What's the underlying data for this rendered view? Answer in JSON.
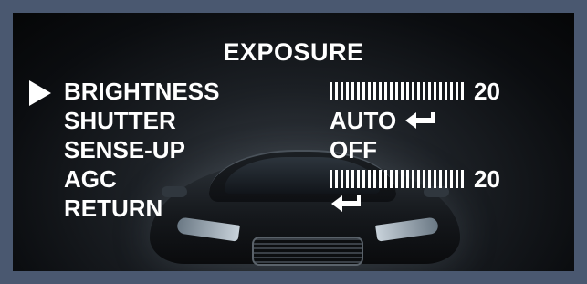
{
  "menu": {
    "title": "EXPOSURE",
    "items": [
      {
        "label": "BRIGHTNESS",
        "value": "20",
        "bar_level": 20,
        "selected": true
      },
      {
        "label": "SHUTTER",
        "value": "AUTO",
        "icon": "enter-arrow-icon"
      },
      {
        "label": "SENSE-UP",
        "value": "OFF"
      },
      {
        "label": "AGC",
        "value": "20",
        "bar_level": 20
      },
      {
        "label": "RETURN",
        "icon": "enter-arrow-icon"
      }
    ]
  },
  "colors": {
    "frame": "#4a5870",
    "text": "#ffffff",
    "background": "#0b0d10"
  }
}
